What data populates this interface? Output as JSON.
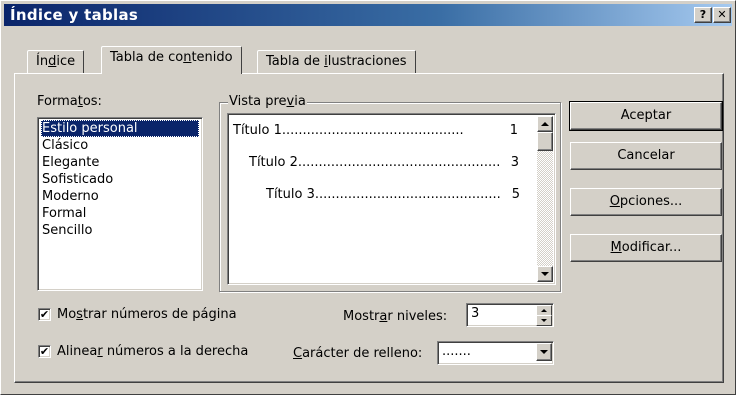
{
  "window": {
    "title": "Índice y tablas",
    "help_glyph": "?",
    "close_glyph": "✕"
  },
  "tabs": [
    {
      "label": "Índice",
      "mnemonic": "d",
      "active": false
    },
    {
      "label": "Tabla de contenido",
      "mnemonic": "n",
      "active": true
    },
    {
      "label": "Tabla de ilustraciones",
      "mnemonic": "i",
      "active": false
    }
  ],
  "formats": {
    "label": "Formatos:",
    "items": [
      "Estilo personal",
      "Clásico",
      "Elegante",
      "Sofisticado",
      "Moderno",
      "Formal",
      "Sencillo"
    ],
    "selected_index": 0
  },
  "preview": {
    "label": "Vista previa",
    "entries": [
      {
        "text": "Título 1",
        "dots": "............................................",
        "page": "1"
      },
      {
        "text": "Título 2",
        "dots": ".................................................",
        "page": "3"
      },
      {
        "text": "Título 3",
        "dots": ".............................................",
        "page": "5"
      }
    ]
  },
  "buttons": {
    "accept": "Aceptar",
    "cancel": "Cancelar",
    "options": "Opciones...",
    "modify": "Modificar..."
  },
  "options": {
    "show_page_numbers": {
      "label": "Mostrar números de página",
      "checked": true
    },
    "align_right": {
      "label": "Alinear números a la derecha",
      "checked": true
    },
    "show_levels_label": "Mostrar niveles:",
    "show_levels_value": "3",
    "tab_leader_label": "Carácter de relleno:",
    "tab_leader_value": "......."
  },
  "colors": {
    "face": "#d4d0c8",
    "title_start": "#0a246a",
    "title_end": "#a6caf0",
    "selection": "#0a246a"
  }
}
